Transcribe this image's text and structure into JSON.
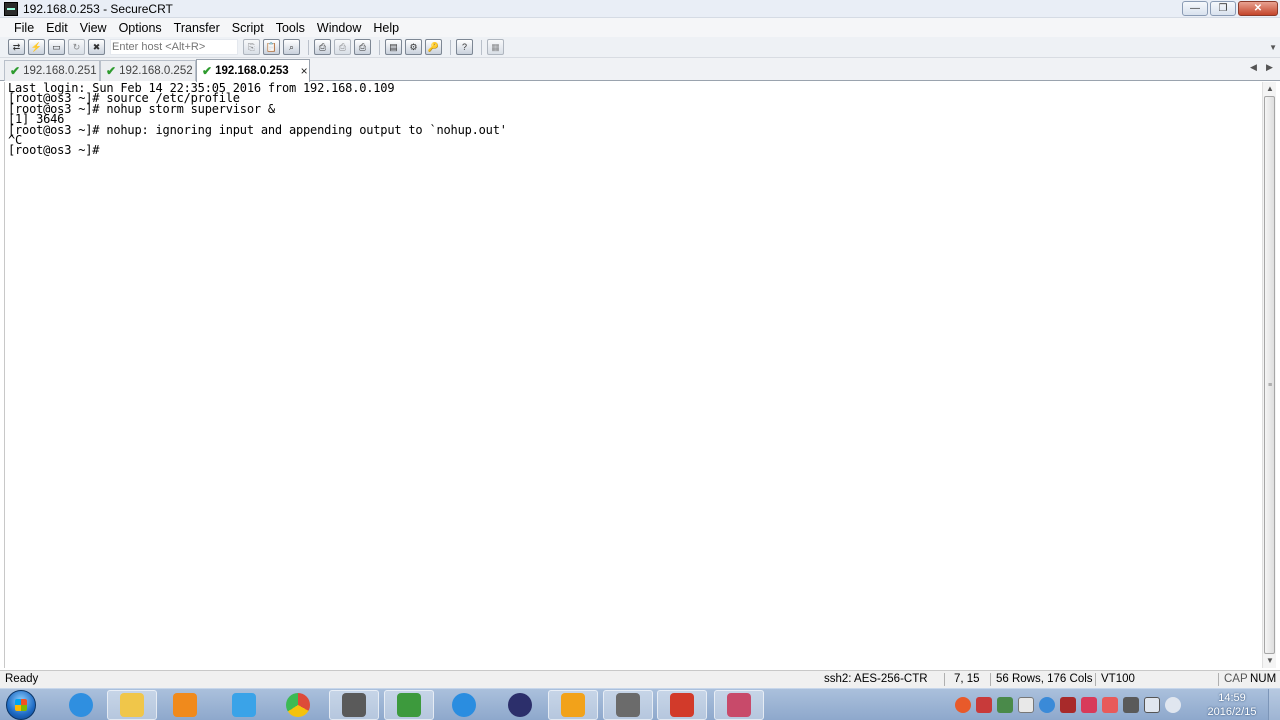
{
  "window": {
    "title": "192.168.0.253 - SecureCRT",
    "controls": {
      "minimize": "—",
      "maximize": "❐",
      "close": "✕"
    }
  },
  "menu": [
    "File",
    "Edit",
    "View",
    "Options",
    "Transfer",
    "Script",
    "Tools",
    "Window",
    "Help"
  ],
  "toolbar": {
    "host_placeholder": "Enter host <Alt+R>"
  },
  "tabs": [
    {
      "label": "192.168.0.251",
      "status_icon": "check-icon",
      "active": false
    },
    {
      "label": "192.168.0.252",
      "status_icon": "check-icon",
      "active": false
    },
    {
      "label": "192.168.0.253",
      "status_icon": "check-icon",
      "active": true,
      "close": "×"
    }
  ],
  "terminal": {
    "lines": [
      "Last login: Sun Feb 14 22:35:05 2016 from 192.168.0.109",
      "[root@os3 ~]# source /etc/profile",
      "[root@os3 ~]# nohup storm supervisor &",
      "[1] 3646",
      "[root@os3 ~]# nohup: ignoring input and appending output to `nohup.out'",
      "^C",
      "[root@os3 ~]#"
    ]
  },
  "status": {
    "ready": "Ready",
    "cipher": "ssh2: AES-256-CTR",
    "cursor": "7,  15",
    "size": "56 Rows, 176 Cols",
    "emulation": "VT100",
    "cap": "CAP",
    "num": "NUM"
  },
  "taskbar": {
    "time": "14:59",
    "date": "2016/2/15",
    "apps": [
      {
        "name": "internet-explorer-icon",
        "color": "#2f8fe0"
      },
      {
        "name": "file-explorer-icon",
        "color": "#f0c64a"
      },
      {
        "name": "media-player-icon",
        "color": "#f08a1c"
      },
      {
        "name": "cloud-sync-icon",
        "color": "#3aa3e8"
      },
      {
        "name": "chrome-icon",
        "color": "#dd4b39"
      },
      {
        "name": "securecrt-icon",
        "color": "#5a5a5a"
      },
      {
        "name": "network-tool-icon",
        "color": "#3d9a3d"
      },
      {
        "name": "notes-icon",
        "color": "#2a8de0"
      },
      {
        "name": "eclipse-icon",
        "color": "#2c2f6b"
      },
      {
        "name": "virtualbox-icon",
        "color": "#f2a21a"
      },
      {
        "name": "securecrt-active-icon",
        "color": "#6b6b6b"
      },
      {
        "name": "pdf-reader-icon",
        "color": "#d23a2a"
      },
      {
        "name": "dragonfly-app-icon",
        "color": "#c84a6a"
      }
    ]
  }
}
